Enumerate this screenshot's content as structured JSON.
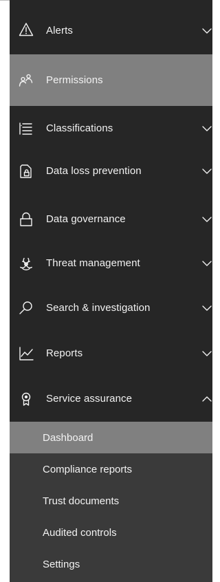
{
  "nav": {
    "items": [
      {
        "label": "Alerts",
        "icon": "warning-icon",
        "chevron": "down",
        "selected": false
      },
      {
        "label": "Permissions",
        "icon": "people-icon",
        "chevron": "none",
        "selected": true
      },
      {
        "label": "Classifications",
        "icon": "list-icon",
        "chevron": "down",
        "selected": false
      },
      {
        "label": "Data loss prevention",
        "icon": "document-lock-icon",
        "chevron": "down",
        "selected": false
      },
      {
        "label": "Data governance",
        "icon": "lock-icon",
        "chevron": "down",
        "selected": false
      },
      {
        "label": "Threat management",
        "icon": "biohazard-icon",
        "chevron": "down",
        "selected": false
      },
      {
        "label": "Search & investigation",
        "icon": "search-icon",
        "chevron": "down",
        "selected": false
      },
      {
        "label": "Reports",
        "icon": "line-chart-icon",
        "chevron": "down",
        "selected": false
      },
      {
        "label": "Service assurance",
        "icon": "ribbon-icon",
        "chevron": "up",
        "selected": false
      }
    ],
    "subitems": [
      {
        "label": "Dashboard",
        "selected": true
      },
      {
        "label": "Compliance reports",
        "selected": false
      },
      {
        "label": "Trust documents",
        "selected": false
      },
      {
        "label": "Audited controls",
        "selected": false
      },
      {
        "label": "Settings",
        "selected": false
      }
    ]
  },
  "colors": {
    "nav_background": "#262626",
    "selected_background": "#808080",
    "subnav_background": "#3a3a3a",
    "text": "#f2f2f2"
  }
}
